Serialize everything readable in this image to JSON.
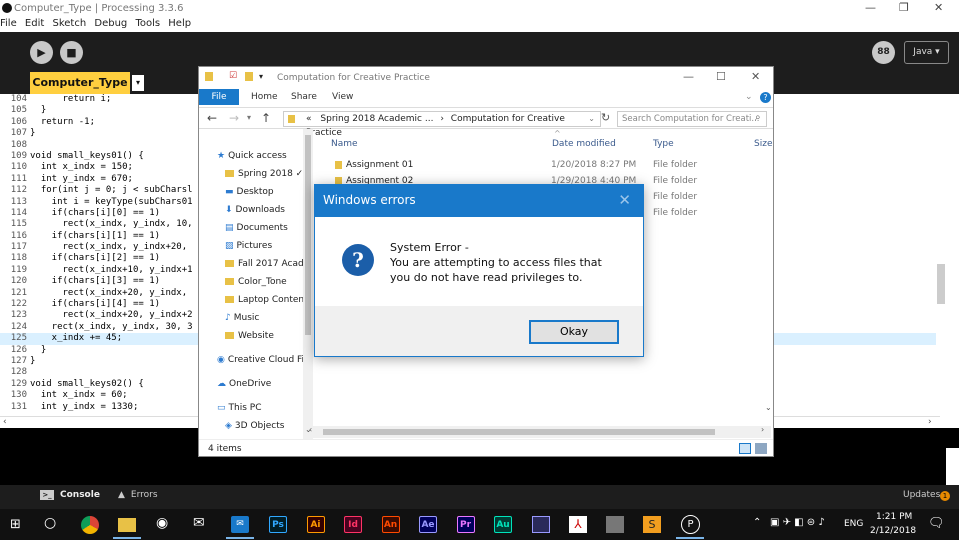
{
  "window": {
    "title": "Computer_Type | Processing 3.3.6"
  },
  "menu": [
    "File",
    "Edit",
    "Sketch",
    "Debug",
    "Tools",
    "Help"
  ],
  "toolbar": {
    "mode": "Java ▾",
    "mode_icon_text": "88"
  },
  "sketch_tab": {
    "label": "Computer_Type",
    "arrow": "▾"
  },
  "editor": {
    "line_numbers": [
      "104",
      "105",
      "106",
      "107",
      "108",
      "109",
      "110",
      "111",
      "112",
      "113",
      "114",
      "115",
      "116",
      "117",
      "118",
      "119",
      "120",
      "121",
      "122",
      "123",
      "124",
      "125",
      "126",
      "127",
      "128",
      "129",
      "130",
      "131"
    ],
    "lines": [
      "      return i;",
      "  }",
      "  return -1;",
      "}",
      "",
      "void small_keys01() {",
      "  int x_indx = 150;",
      "  int y_indx = 670;",
      "  for(int j = 0; j < subCharsl",
      "    int i = keyType(subChars01",
      "    if(chars[i][0] == 1)",
      "      rect(x_indx, y_indx, 10,",
      "    if(chars[i][1] == 1)",
      "      rect(x_indx, y_indx+20,",
      "    if(chars[i][2] == 1)",
      "      rect(x_indx+10, y_indx+1",
      "    if(chars[i][3] == 1)",
      "      rect(x_indx+20, y_indx,",
      "    if(chars[i][4] == 1)",
      "      rect(x_indx+20, y_indx+2",
      "    rect(x_indx, y_indx, 30, 3",
      "    x_indx += 45;",
      "  }",
      "}",
      "",
      "void small_keys02() {",
      "  int x_indx = 60;",
      "  int y_indx = 1330;"
    ],
    "highlighted_line": "125"
  },
  "footer": {
    "console": "Console",
    "errors": "Errors",
    "updates": "Updates",
    "updates_count": "1"
  },
  "explorer": {
    "title": "Computation for Creative Practice",
    "ribbon": {
      "file": "File",
      "home": "Home",
      "share": "Share",
      "view": "View"
    },
    "breadcrumb": [
      "«",
      "Spring 2018 Academic ...",
      "›",
      "Computation for Creative Practice"
    ],
    "search_placeholder": "Search Computation for Creati...",
    "nav": [
      {
        "label": "Quick access",
        "type": "star"
      },
      {
        "label": "Spring 2018 ✓",
        "type": "folder"
      },
      {
        "label": "Desktop",
        "type": "desktop"
      },
      {
        "label": "Downloads",
        "type": "download"
      },
      {
        "label": "Documents",
        "type": "doc"
      },
      {
        "label": "Pictures",
        "type": "pic"
      },
      {
        "label": "Fall 2017 Acad",
        "type": "folder"
      },
      {
        "label": "Color_Tone",
        "type": "folder"
      },
      {
        "label": "Laptop Content",
        "type": "folder"
      },
      {
        "label": "Music",
        "type": "music"
      },
      {
        "label": "Website",
        "type": "folder"
      },
      {
        "label": "Creative Cloud File",
        "type": "cc"
      },
      {
        "label": "OneDrive",
        "type": "cloud"
      },
      {
        "label": "This PC",
        "type": "pc"
      },
      {
        "label": "3D Objects",
        "type": "3d"
      }
    ],
    "columns": {
      "name": "Name",
      "date": "Date modified",
      "type": "Type",
      "size": "Size"
    },
    "files": [
      {
        "name": "Assignment 01",
        "date": "1/20/2018 8:27 PM",
        "type": "File folder"
      },
      {
        "name": "Assignment 02",
        "date": "1/29/2018 4:40 PM",
        "type": "File folder"
      },
      {
        "name": "",
        "date": "",
        "type": "File folder"
      },
      {
        "name": "",
        "date": "",
        "type": "File folder"
      }
    ],
    "status": "4 items"
  },
  "dialog": {
    "title": "Windows errors",
    "close": "✕",
    "message_title": "System Error -",
    "message_line1": "You are attempting to access files that",
    "message_line2": "you do not have read privileges to.",
    "button": "Okay"
  },
  "taskbar": {
    "apps": [
      {
        "label": "Ps",
        "bg": "#001d26",
        "fg": "#31a8ff"
      },
      {
        "label": "Ai",
        "bg": "#330000",
        "fg": "#ff9a00"
      },
      {
        "label": "Id",
        "bg": "#49021f",
        "fg": "#ff3366"
      },
      {
        "label": "An",
        "bg": "#3a0a00",
        "fg": "#ff4a00"
      },
      {
        "label": "Ae",
        "bg": "#00005b",
        "fg": "#9999ff"
      },
      {
        "label": "Pr",
        "bg": "#00005b",
        "fg": "#ea77ff"
      },
      {
        "label": "Au",
        "bg": "#003c33",
        "fg": "#00e4bb"
      }
    ],
    "lang": "ENG",
    "time": "1:21 PM",
    "date": "2/12/2018"
  },
  "colors": {
    "accent": "#1979ca",
    "processing_tab": "#ffcf3f",
    "dark_bg": "#1d1d1d"
  }
}
